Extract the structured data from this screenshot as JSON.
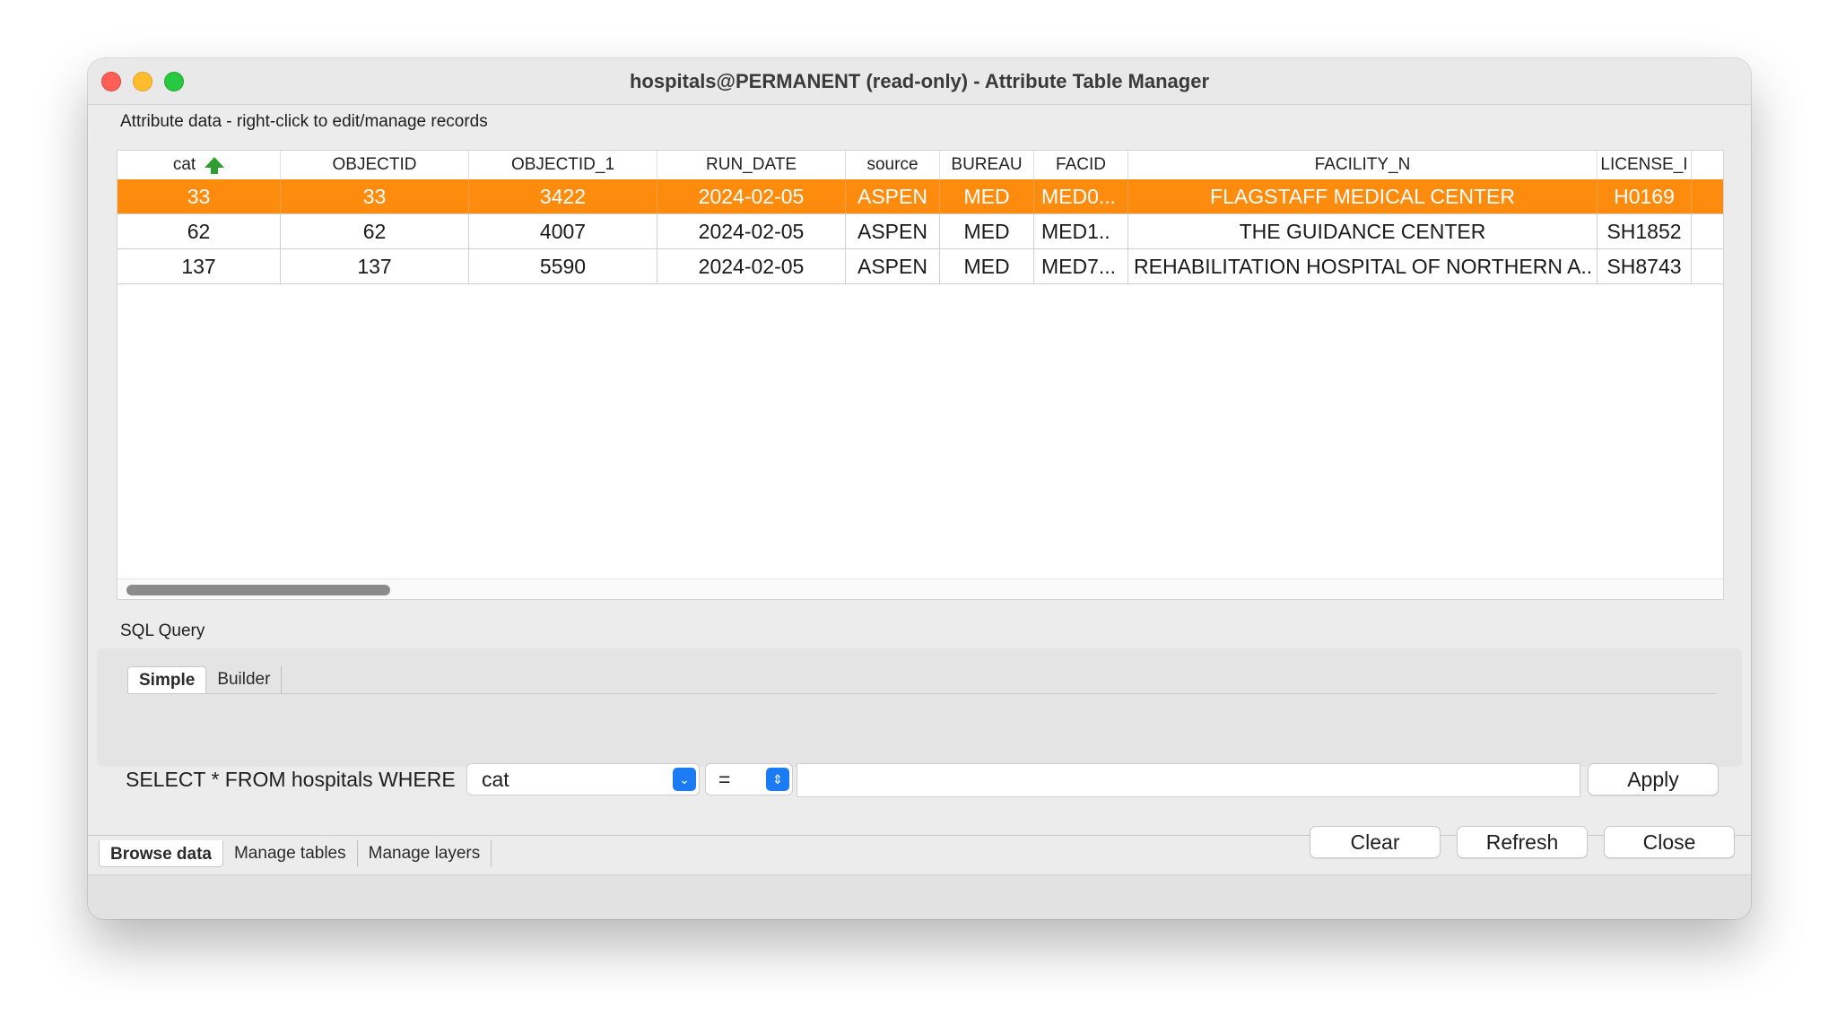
{
  "window": {
    "title": "hospitals@PERMANENT (read-only) - Attribute Table Manager"
  },
  "attribute_label": "Attribute data - right-click to edit/manage records",
  "table": {
    "columns": [
      "cat",
      "OBJECTID",
      "OBJECTID_1",
      "RUN_DATE",
      "source",
      "BUREAU",
      "FACID",
      "FACILITY_N",
      "LICENSE_I"
    ],
    "rows": [
      [
        "33",
        "33",
        "3422",
        "2024-02-05",
        "ASPEN",
        "MED",
        "MED0...",
        "FLAGSTAFF MEDICAL CENTER",
        "H0169"
      ],
      [
        "62",
        "62",
        "4007",
        "2024-02-05",
        "ASPEN",
        "MED",
        "MED1..",
        "THE GUIDANCE CENTER",
        "SH1852"
      ],
      [
        "137",
        "137",
        "5590",
        "2024-02-05",
        "ASPEN",
        "MED",
        "MED7...",
        "REHABILITATION HOSPITAL OF NORTHERN A..",
        "SH8743"
      ]
    ],
    "selected_row": 0,
    "selection_color": "#fd8c0e",
    "sort_icon": "sort-ascending-arrow-icon"
  },
  "sql": {
    "section_label": "SQL Query",
    "tabs": [
      "Simple",
      "Builder"
    ],
    "prefix": "SELECT * FROM hospitals WHERE",
    "column_value": "cat",
    "operator_value": "=",
    "value": "",
    "apply_label": "Apply"
  },
  "main_tabs": [
    "Browse data",
    "Manage tables",
    "Manage layers"
  ],
  "buttons": {
    "clear": "Clear",
    "refresh": "Refresh",
    "close": "Close"
  }
}
